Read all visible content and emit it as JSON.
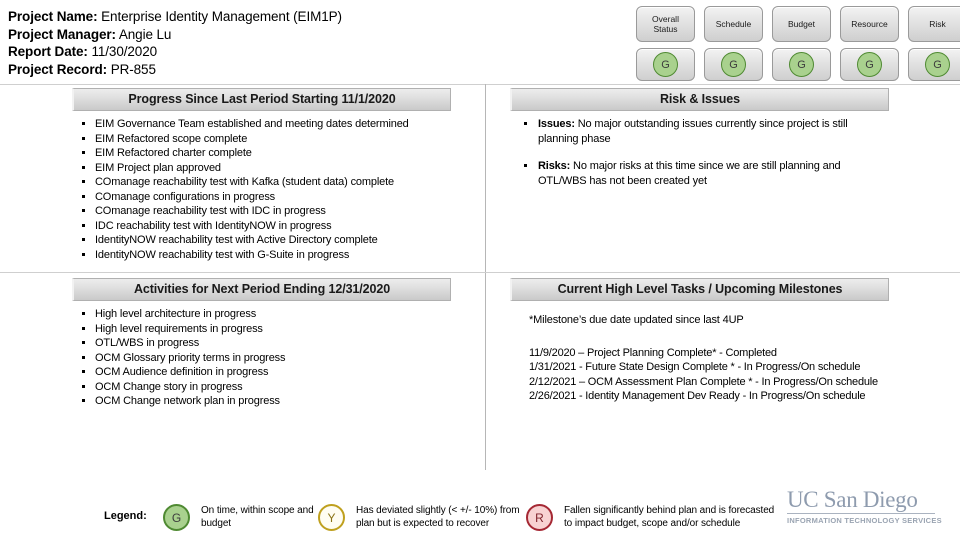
{
  "header": {
    "lines": [
      {
        "label": "Project Name:",
        "value": "Enterprise Identity Management (EIM1P)"
      },
      {
        "label": "Project Manager:",
        "value": "Angie Lu"
      },
      {
        "label": "Report Date:",
        "value": "11/30/2020"
      },
      {
        "label": "Project Record:",
        "value": "PR-855"
      }
    ]
  },
  "status_indicators": [
    {
      "label": "Overall Status",
      "value": "G",
      "color": "#a9d18e"
    },
    {
      "label": "Schedule",
      "value": "G",
      "color": "#a9d18e"
    },
    {
      "label": "Budget",
      "value": "G",
      "color": "#a9d18e"
    },
    {
      "label": "Resource",
      "value": "G",
      "color": "#a9d18e"
    },
    {
      "label": "Risk",
      "value": "G",
      "color": "#a9d18e"
    }
  ],
  "panels": {
    "progress": {
      "title": "Progress Since Last Period Starting 11/1/2020",
      "items": [
        "EIM Governance Team established and meeting dates determined",
        "EIM Refactored scope complete",
        "EIM Refactored charter complete",
        "EIM Project plan approved",
        "COmanage reachability test with Kafka (student data) complete",
        "COmanage configurations in progress",
        "COmanage reachability test with IDC in progress",
        "IDC reachability test with IdentityNOW in progress",
        "IdentityNOW reachability test with Active Directory complete",
        "IdentityNOW reachability test with G-Suite in progress"
      ]
    },
    "risk_issues": {
      "title": "Risk & Issues",
      "items": [
        {
          "lead": "Issues:",
          "text": " No major outstanding issues currently since project is still planning phase"
        },
        {
          "lead": "Risks:",
          "text": " No major risks at this time since we are still planning and OTL/WBS has not been created yet"
        }
      ]
    },
    "activities": {
      "title": "Activities for Next Period Ending 12/31/2020",
      "items": [
        "High level architecture in progress",
        "High level requirements in progress",
        "OTL/WBS in progress",
        "OCM Glossary priority terms in progress",
        "OCM Audience definition in progress",
        "OCM Change story in progress",
        "OCM Change network plan in progress"
      ]
    },
    "milestones": {
      "title": "Current High Level Tasks / Upcoming Milestones",
      "note": "*Milestone’s due date updated since last 4UP",
      "rows": [
        "11/9/2020 – Project Planning Complete* - Completed",
        "1/31/2021 - Future State Design Complete * - In Progress/On schedule",
        "2/12/2021 – OCM Assessment Plan Complete * - In Progress/On schedule",
        "2/26/2021 - Identity Management Dev Ready - In Progress/On schedule"
      ]
    }
  },
  "legend": {
    "label": "Legend:",
    "items": [
      {
        "symbol": "G",
        "text": "On time, within scope and budget",
        "color": "#a9d18e"
      },
      {
        "symbol": "Y",
        "text": "Has deviated slightly (< +/- 10%) from plan but is expected to recover",
        "color": "#bfa01e"
      },
      {
        "symbol": "R",
        "text": "Fallen significantly behind plan and is forecasted to impact budget, scope and/or schedule",
        "color": "#a52834"
      }
    ]
  },
  "logo": {
    "wordmark": "UC San Diego",
    "tagline": "INFORMATION TECHNOLOGY SERVICES"
  }
}
